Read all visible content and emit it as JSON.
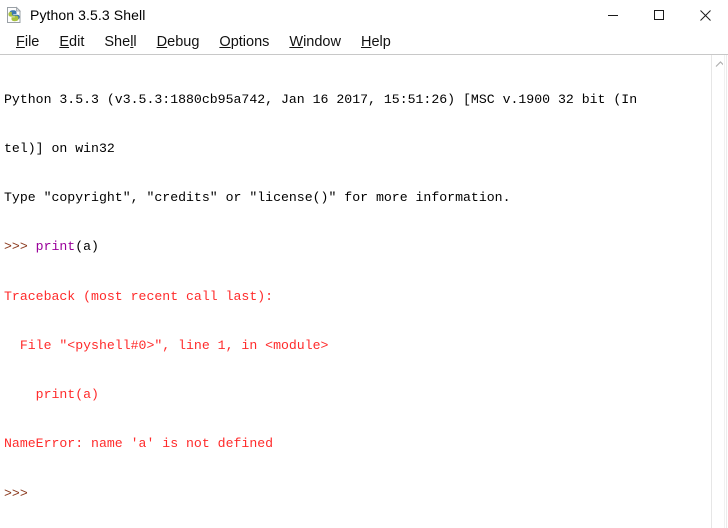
{
  "window": {
    "title": "Python 3.5.3 Shell",
    "icon": "python-idle-icon",
    "caption": {
      "minimize": "minimize-button",
      "maximize": "maximize-button",
      "close": "close-button"
    }
  },
  "menubar": {
    "items": [
      {
        "label": "File",
        "accel": "F",
        "rest": "ile"
      },
      {
        "label": "Edit",
        "accel": "E",
        "rest": "dit"
      },
      {
        "label": "Shell",
        "accel": "l",
        "pre": "She",
        "rest": "l"
      },
      {
        "label": "Debug",
        "accel": "D",
        "rest": "ebug"
      },
      {
        "label": "Options",
        "accel": "O",
        "rest": "ptions"
      },
      {
        "label": "Window",
        "accel": "W",
        "rest": "indow"
      },
      {
        "label": "Help",
        "accel": "H",
        "rest": "elp"
      }
    ]
  },
  "shell": {
    "banner_line1": "Python 3.5.3 (v3.5.3:1880cb95a742, Jan 16 2017, 15:51:26) [MSC v.1900 32 bit (In",
    "banner_line2": "tel)] on win32",
    "banner_line3": "Type \"copyright\", \"credits\" or \"license()\" for more information.",
    "prompt1": ">>> ",
    "command_keyword": "print",
    "command_args": "(a)",
    "traceback_header": "Traceback (most recent call last):",
    "traceback_file": "  File \"<pyshell#0>\", line 1, in <module>",
    "traceback_code": "    print(a)",
    "traceback_error": "NameError: name 'a' is not defined",
    "prompt2": ">>> "
  },
  "scrollbar": {
    "up_arrow": "scroll-up-arrow"
  },
  "colors": {
    "prompt": "#8b3a1e",
    "keyword": "#9a009a",
    "error": "#ff2b2b",
    "text": "#000000",
    "background": "#ffffff"
  }
}
